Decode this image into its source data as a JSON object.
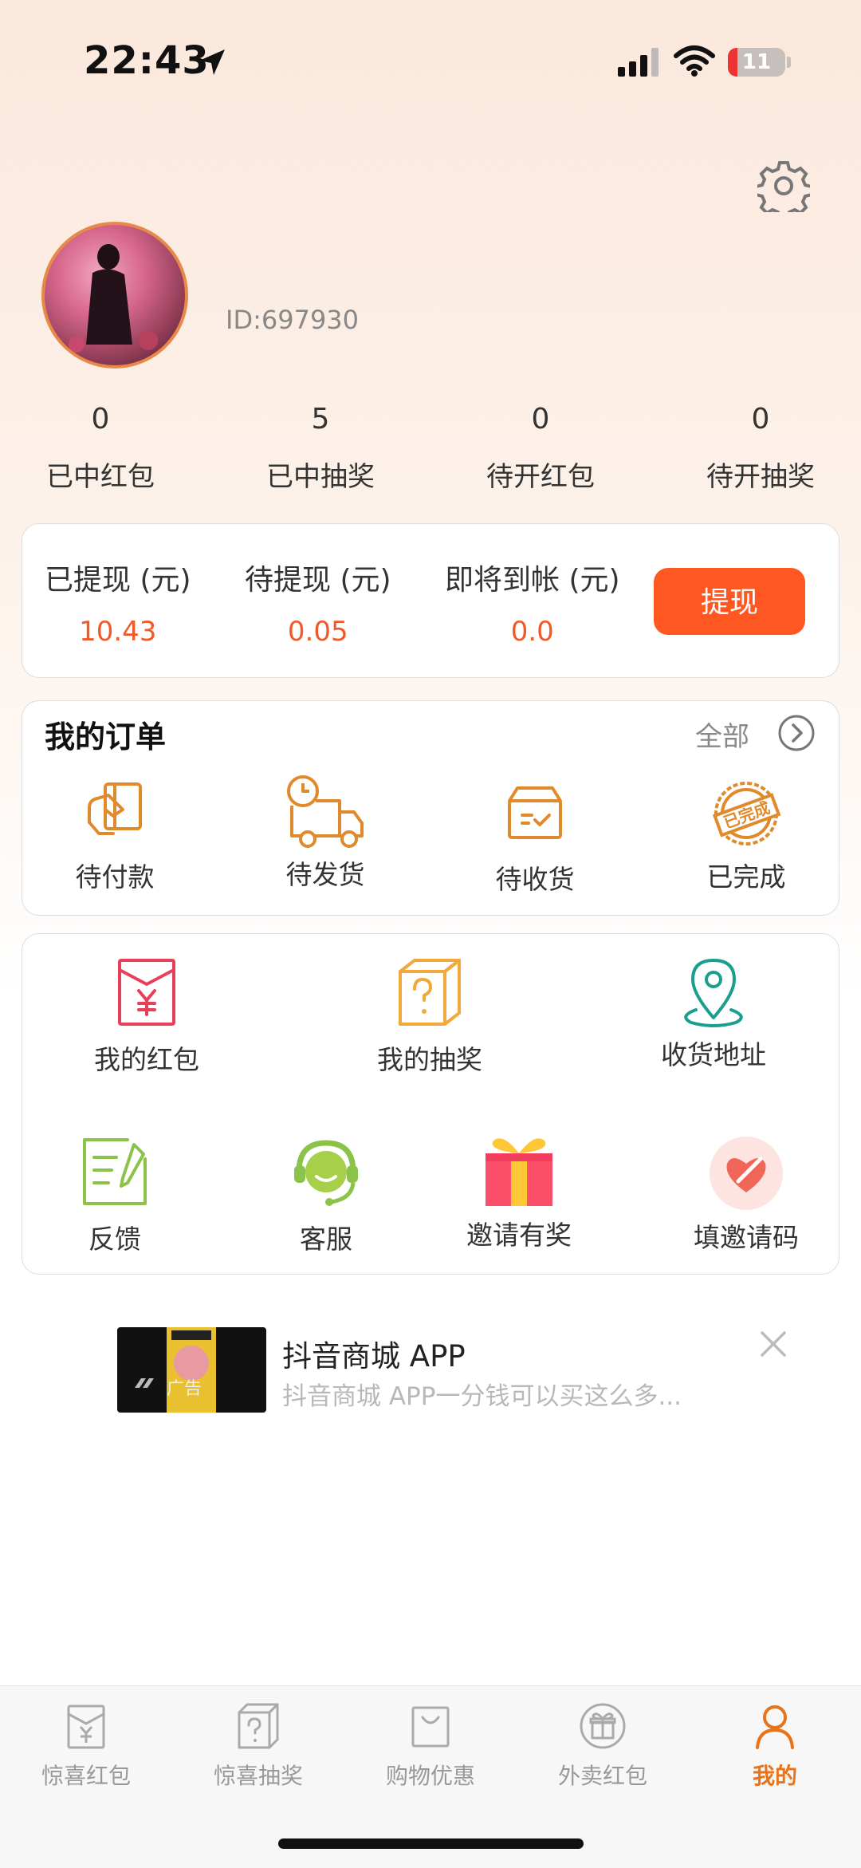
{
  "status_bar": {
    "time": "22:43",
    "battery": "11"
  },
  "profile": {
    "user_id": "ID:697930"
  },
  "stats": [
    {
      "value": "0",
      "label": "已中红包"
    },
    {
      "value": "5",
      "label": "已中抽奖"
    },
    {
      "value": "0",
      "label": "待开红包"
    },
    {
      "value": "0",
      "label": "待开抽奖"
    }
  ],
  "withdraw": {
    "withdrawn_label": "已提现 (元)",
    "withdrawn_value": "10.43",
    "pending_label": "待提现 (元)",
    "pending_value": "0.05",
    "arriving_label": "即将到帐 (元)",
    "arriving_value": "0.0",
    "button": "提现"
  },
  "orders": {
    "title": "我的订单",
    "all_label": "全部",
    "items": [
      {
        "label": "待付款",
        "icon": "card-hand-icon"
      },
      {
        "label": "待发货",
        "icon": "delivery-truck-icon"
      },
      {
        "label": "待收货",
        "icon": "parcel-box-icon"
      },
      {
        "label": "已完成",
        "icon": "completed-stamp-icon",
        "stamp_text": "已完成"
      }
    ]
  },
  "services": {
    "row1": [
      {
        "label": "我的红包",
        "icon": "red-envelope-icon"
      },
      {
        "label": "我的抽奖",
        "icon": "mystery-box-icon"
      },
      {
        "label": "收货地址",
        "icon": "location-pin-icon"
      }
    ],
    "row2": [
      {
        "label": "反馈",
        "icon": "feedback-note-icon"
      },
      {
        "label": "客服",
        "icon": "customer-service-icon"
      },
      {
        "label": "邀请有奖",
        "icon": "gift-icon"
      },
      {
        "label": "填邀请码",
        "icon": "heart-pen-icon"
      }
    ]
  },
  "ad": {
    "title": "抖音商城 APP",
    "description": "抖音商城 APP一分钱可以买这么多...",
    "badge": "广告"
  },
  "tabbar": [
    {
      "label": "惊喜红包",
      "icon": "envelope-tab-icon",
      "active": false
    },
    {
      "label": "惊喜抽奖",
      "icon": "box-tab-icon",
      "active": false
    },
    {
      "label": "购物优惠",
      "icon": "bag-tab-icon",
      "active": false
    },
    {
      "label": "外卖红包",
      "icon": "gift-circle-tab-icon",
      "active": false
    },
    {
      "label": "我的",
      "icon": "user-tab-icon",
      "active": true
    }
  ],
  "colors": {
    "accent": "#ff5722",
    "amount": "#f05a28",
    "tab_active": "#e8731a",
    "order_icon": "#e08a2c"
  }
}
